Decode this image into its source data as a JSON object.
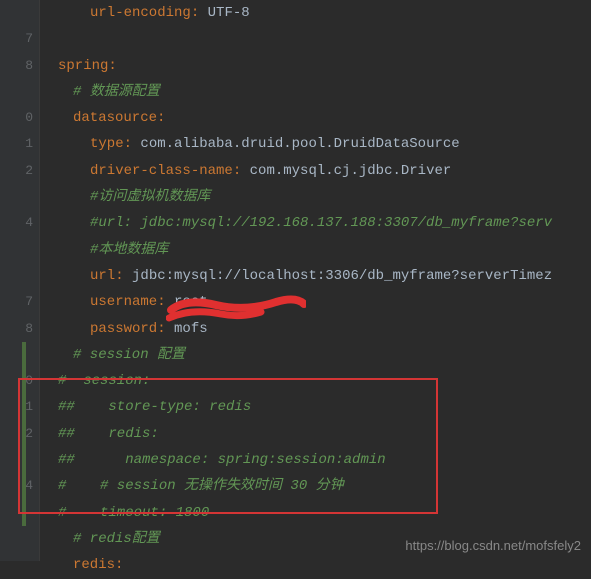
{
  "lines": [
    {
      "num": "",
      "indent": 3,
      "parts": [
        {
          "cls": "key",
          "txt": "url-encoding"
        },
        {
          "cls": "colon",
          "txt": ": "
        },
        {
          "cls": "value",
          "txt": "UTF-8"
        }
      ]
    },
    {
      "num": "",
      "indent": 1,
      "parts": []
    },
    {
      "num": "",
      "indent": 1,
      "parts": [
        {
          "cls": "key",
          "txt": "spring"
        },
        {
          "cls": "colon",
          "txt": ":"
        }
      ]
    },
    {
      "num": "",
      "indent": 2,
      "parts": [
        {
          "cls": "comment2",
          "txt": "# 数据源配置"
        }
      ]
    },
    {
      "num": "",
      "indent": 2,
      "parts": [
        {
          "cls": "key",
          "txt": "datasource"
        },
        {
          "cls": "colon",
          "txt": ":"
        }
      ]
    },
    {
      "num": "",
      "indent": 3,
      "parts": [
        {
          "cls": "key",
          "txt": "type"
        },
        {
          "cls": "colon",
          "txt": ": "
        },
        {
          "cls": "value",
          "txt": "com.alibaba.druid.pool.DruidDataSource"
        }
      ]
    },
    {
      "num": "",
      "indent": 3,
      "parts": [
        {
          "cls": "key",
          "txt": "driver-class-name"
        },
        {
          "cls": "colon",
          "txt": ": "
        },
        {
          "cls": "value",
          "txt": "com.mysql.cj.jdbc.Driver"
        }
      ]
    },
    {
      "num": "",
      "indent": 3,
      "parts": [
        {
          "cls": "comment2",
          "txt": "#访问虚拟机数据库"
        }
      ]
    },
    {
      "num": "",
      "indent": 3,
      "parts": [
        {
          "cls": "comment2",
          "txt": "#url: jdbc:mysql://192.168.137.188:3307/db_myframe?serv"
        }
      ]
    },
    {
      "num": "",
      "indent": 3,
      "parts": [
        {
          "cls": "comment2",
          "txt": "#本地数据库"
        }
      ]
    },
    {
      "num": "",
      "indent": 3,
      "parts": [
        {
          "cls": "key",
          "txt": "url"
        },
        {
          "cls": "colon",
          "txt": ": "
        },
        {
          "cls": "value",
          "txt": "jdbc:mysql://localhost:3306/db_myframe?serverTimez"
        }
      ]
    },
    {
      "num": "",
      "indent": 3,
      "parts": [
        {
          "cls": "key",
          "txt": "username"
        },
        {
          "cls": "colon",
          "txt": ": "
        },
        {
          "cls": "value",
          "txt": "root"
        }
      ]
    },
    {
      "num": "",
      "indent": 3,
      "parts": [
        {
          "cls": "key",
          "txt": "password"
        },
        {
          "cls": "colon",
          "txt": ": "
        },
        {
          "cls": "value",
          "txt": "mofs"
        }
      ]
    },
    {
      "num": "",
      "indent": 2,
      "parts": [
        {
          "cls": "comment2",
          "txt": "# session 配置"
        }
      ]
    },
    {
      "num": "",
      "indent": 1,
      "parts": [
        {
          "cls": "comment2",
          "txt": "#  session:"
        }
      ]
    },
    {
      "num": "",
      "indent": 1,
      "parts": [
        {
          "cls": "comment2",
          "txt": "##    store-type: redis"
        }
      ]
    },
    {
      "num": "",
      "indent": 1,
      "parts": [
        {
          "cls": "comment2",
          "txt": "##    redis:"
        }
      ]
    },
    {
      "num": "",
      "indent": 1,
      "parts": [
        {
          "cls": "comment2",
          "txt": "##      namespace: spring:session:admin"
        }
      ]
    },
    {
      "num": "",
      "indent": 1,
      "parts": [
        {
          "cls": "comment2",
          "txt": "#    # session 无操作失效时间 30 分钟"
        }
      ]
    },
    {
      "num": "",
      "indent": 1,
      "parts": [
        {
          "cls": "comment2",
          "txt": "#    timeout: 1800"
        }
      ]
    },
    {
      "num": "",
      "indent": 2,
      "parts": [
        {
          "cls": "comment2",
          "txt": "# redis配置"
        }
      ]
    },
    {
      "num": "",
      "indent": 2,
      "parts": [
        {
          "cls": "key",
          "txt": "redis"
        },
        {
          "cls": "colon",
          "txt": ":"
        }
      ]
    }
  ],
  "watermark": "https://blog.csdn.net/mofsfely2"
}
